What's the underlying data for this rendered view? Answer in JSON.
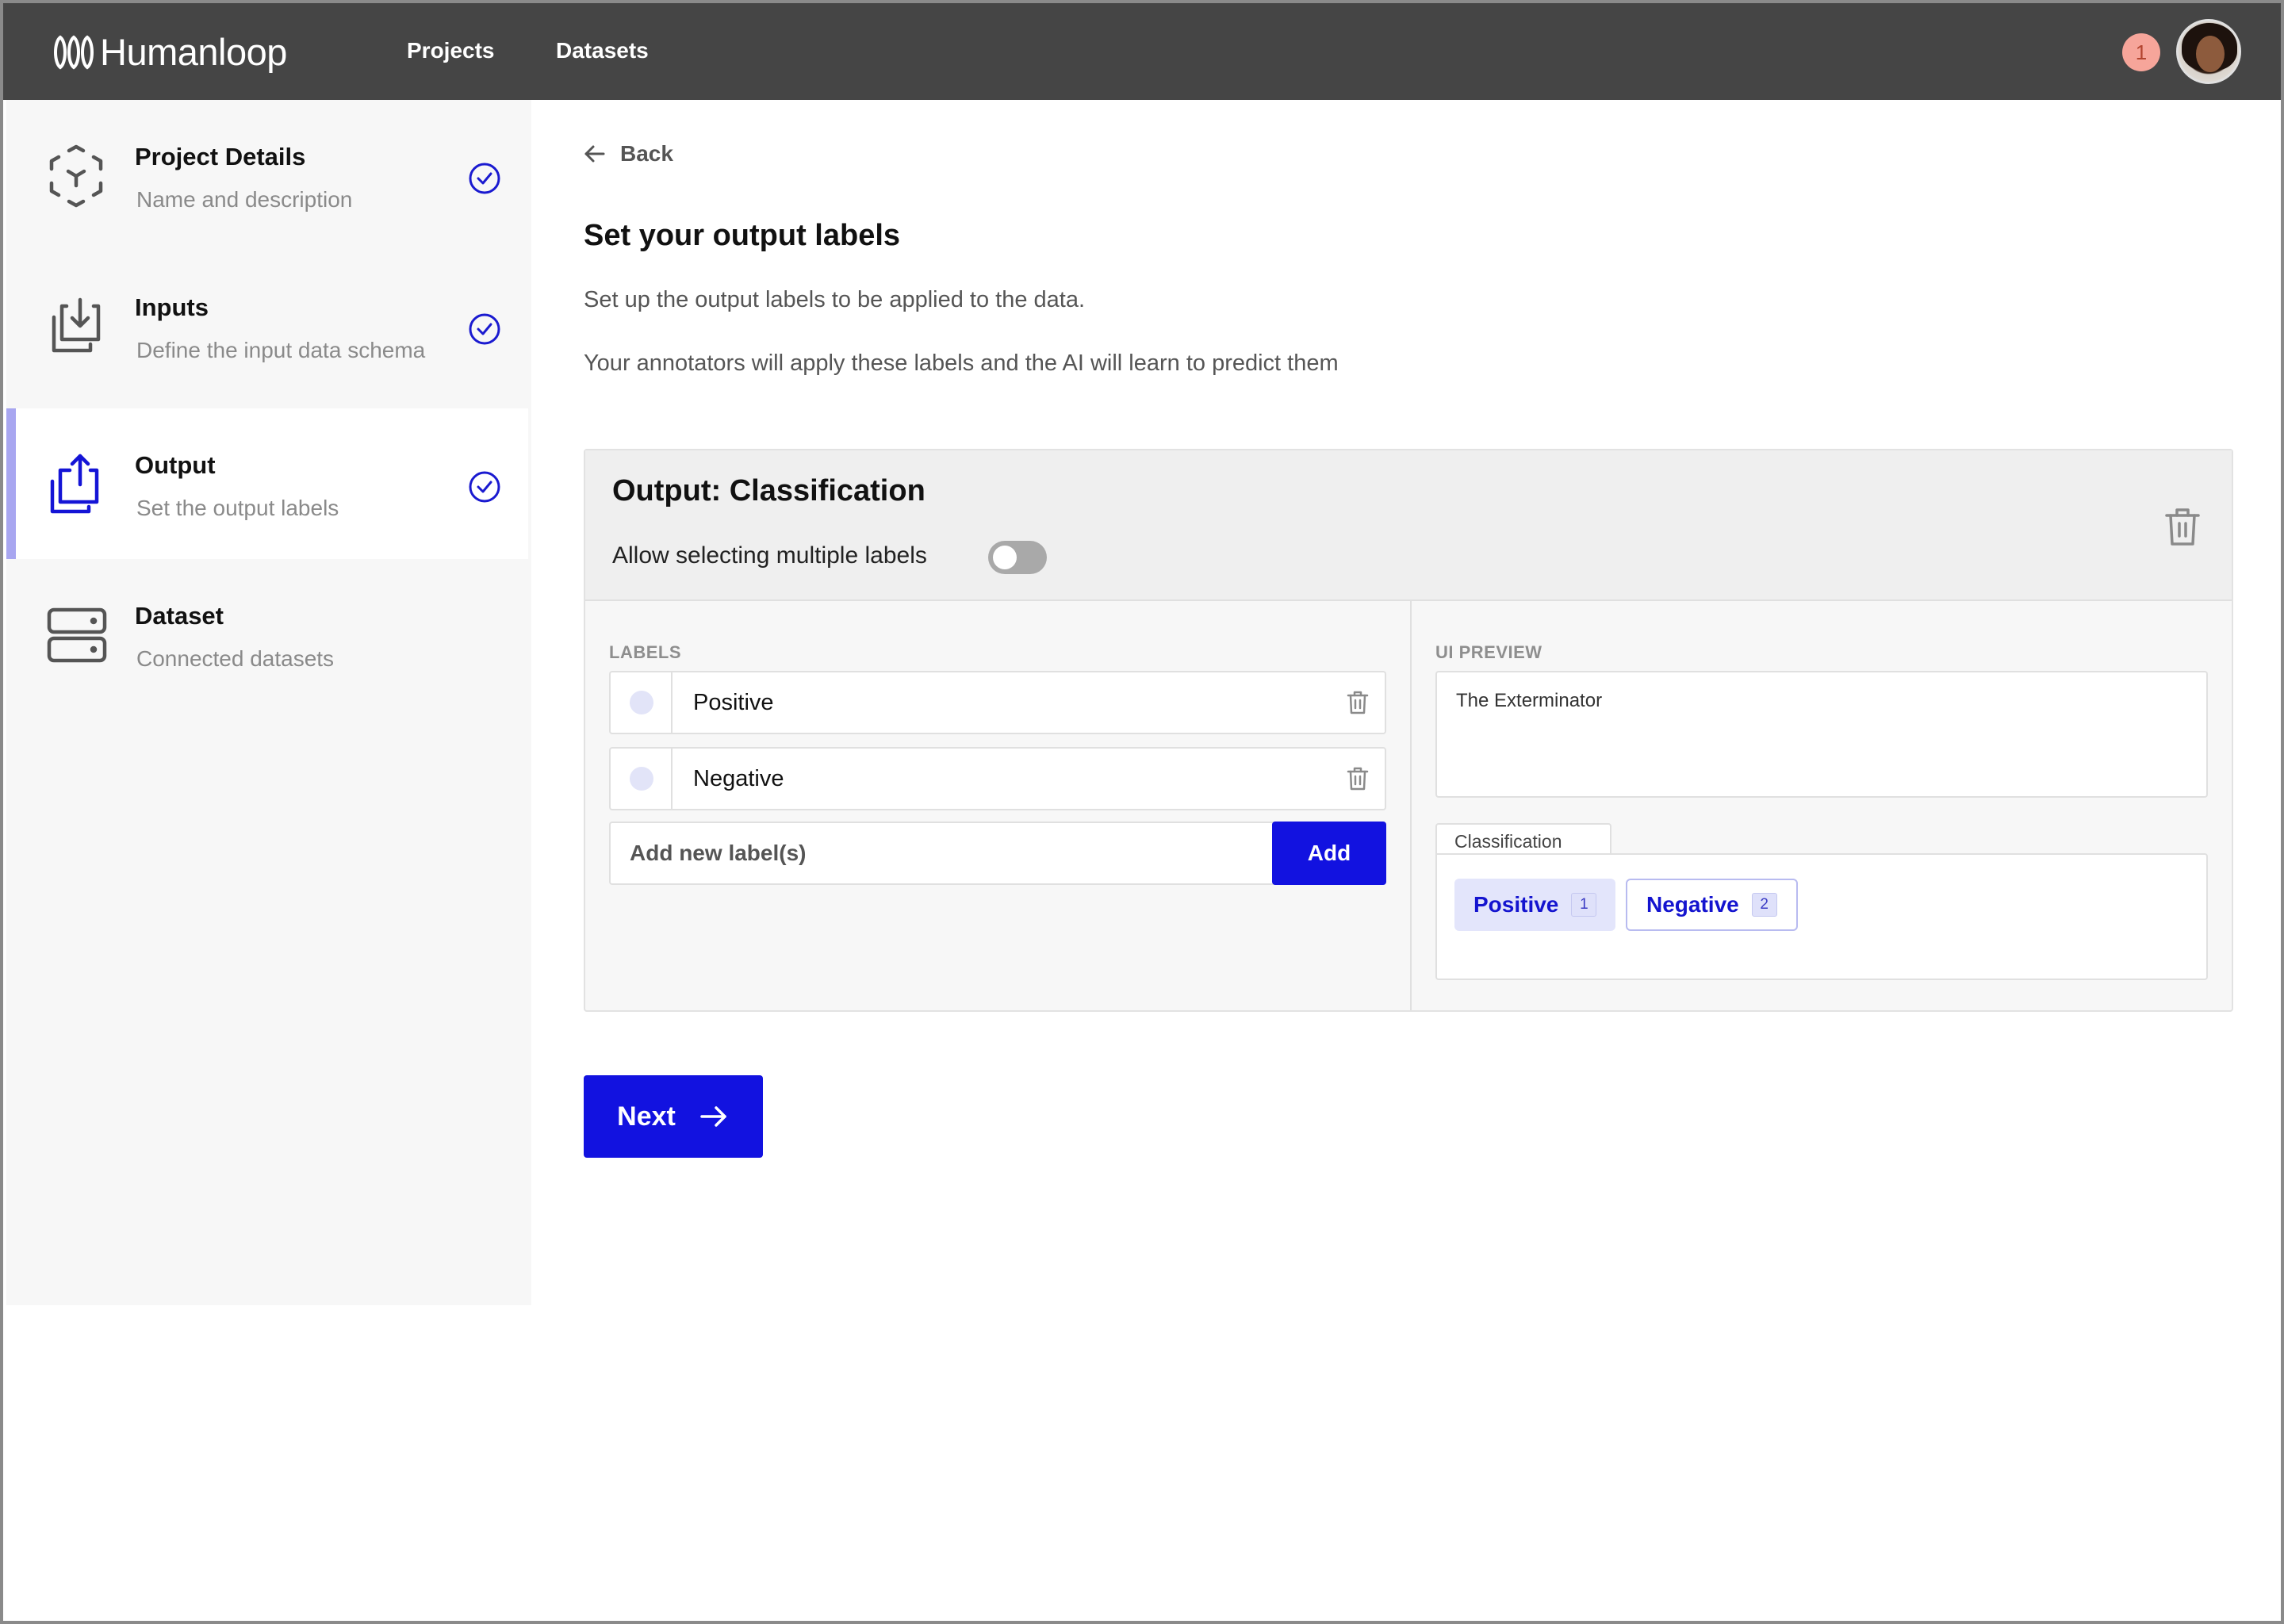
{
  "app": {
    "brand": "Humanloop",
    "nav": [
      "Projects",
      "Datasets"
    ],
    "notification_count": "1"
  },
  "sidebar": {
    "steps": [
      {
        "title": "Project Details",
        "subtitle": "Name and description",
        "icon": "cube-icon",
        "complete": true,
        "active": false
      },
      {
        "title": "Inputs",
        "subtitle": "Define the input data schema",
        "icon": "import-icon",
        "complete": true,
        "active": false
      },
      {
        "title": "Output",
        "subtitle": "Set the output labels",
        "icon": "export-icon",
        "complete": true,
        "active": true
      },
      {
        "title": "Dataset",
        "subtitle": "Connected datasets",
        "icon": "server-icon",
        "complete": false,
        "active": false
      }
    ]
  },
  "main": {
    "back_label": "Back",
    "title": "Set your output labels",
    "description_1": "Set up the output labels to be applied to the data.",
    "description_2": "Your annotators will apply these labels and the AI will learn to predict them",
    "output_card": {
      "title": "Output: Classification",
      "multi_select_label": "Allow selecting multiple labels",
      "multi_select_enabled": false,
      "labels_heading": "LABELS",
      "labels": [
        "Positive",
        "Negative"
      ],
      "add_placeholder": "Add new label(s)",
      "add_button": "Add",
      "preview_heading": "UI PREVIEW",
      "preview_text": "The Exterminator",
      "classification_tab": "Classification",
      "chips": [
        {
          "label": "Positive",
          "key": "1",
          "selected": true
        },
        {
          "label": "Negative",
          "key": "2",
          "selected": false
        }
      ]
    },
    "next_button": "Next"
  },
  "colors": {
    "topbar": "#454545",
    "primary": "#1212e0",
    "active_bar": "#a8a6f0",
    "notification_bg": "#f6a59a"
  }
}
